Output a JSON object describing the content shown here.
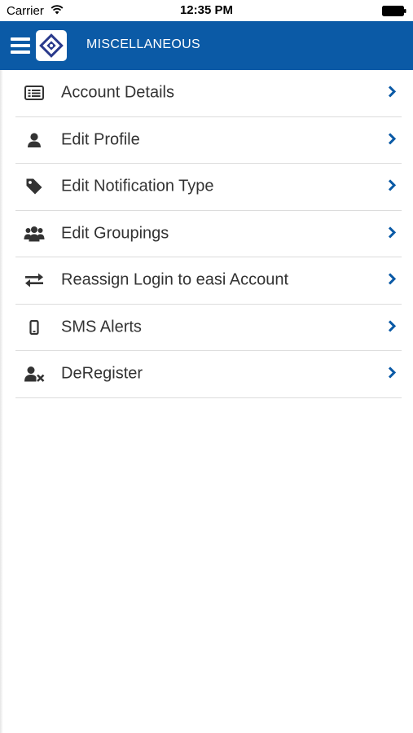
{
  "status_bar": {
    "carrier": "Carrier",
    "time": "12:35 PM"
  },
  "nav": {
    "title": "MISCELLANEOUS",
    "bar_color": "#0b5aa6"
  },
  "menu": [
    {
      "label": "Account Details",
      "icon": "id-card-icon"
    },
    {
      "label": "Edit Profile",
      "icon": "user-icon"
    },
    {
      "label": "Edit Notification Type",
      "icon": "tag-icon"
    },
    {
      "label": "Edit Groupings",
      "icon": "users-group-icon"
    },
    {
      "label": "Reassign Login to easi Account",
      "icon": "exchange-arrows-icon"
    },
    {
      "label": "SMS Alerts",
      "icon": "mobile-phone-icon"
    },
    {
      "label": "DeRegister",
      "icon": "user-remove-icon"
    }
  ],
  "colors": {
    "accent": "#0b5aa6",
    "text": "#333333",
    "chevron": "#0b5aa6",
    "divider": "#dcdcdc"
  }
}
